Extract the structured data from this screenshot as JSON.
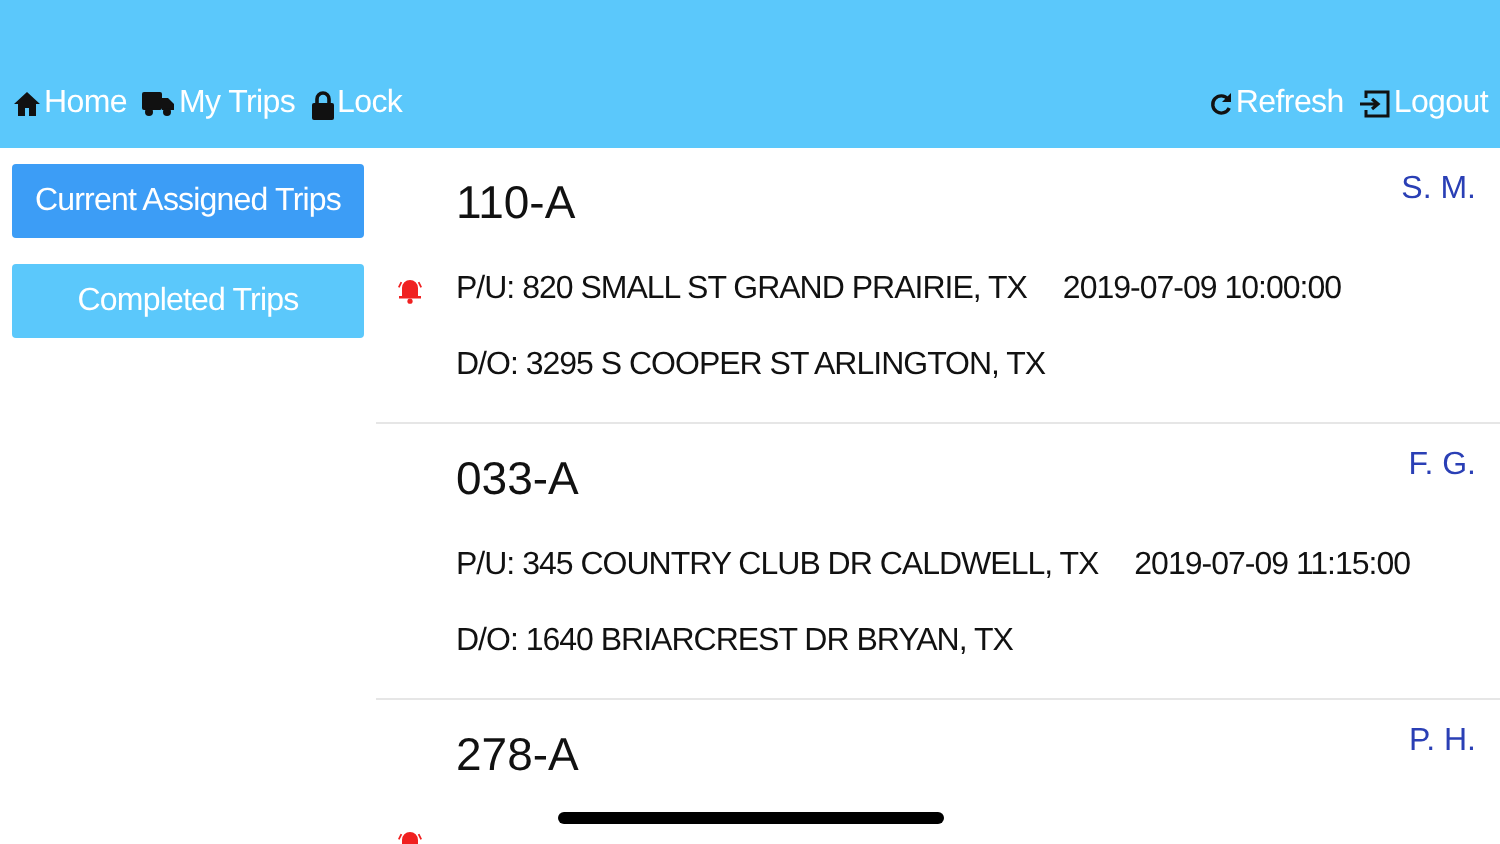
{
  "nav": {
    "left": [
      {
        "label": "Home",
        "kind": "home"
      },
      {
        "label": "My Trips",
        "kind": "truck"
      },
      {
        "label": "Lock",
        "kind": "lock"
      }
    ],
    "right": [
      {
        "label": "Refresh",
        "kind": "refresh"
      },
      {
        "label": "Logout",
        "kind": "logout"
      }
    ]
  },
  "sidebar": {
    "items": [
      {
        "label": "Current Assigned Trips",
        "selected": true
      },
      {
        "label": "Completed Trips",
        "selected": false
      }
    ]
  },
  "trips": [
    {
      "id": "110-A",
      "driver": "S. M.",
      "alert": true,
      "pickup": "P/U: 820 SMALL ST GRAND PRAIRIE, TX",
      "time": "2019-07-09 10:00:00",
      "dropoff": "D/O: 3295 S COOPER ST ARLINGTON, TX"
    },
    {
      "id": "033-A",
      "driver": "F. G.",
      "alert": false,
      "pickup": "P/U: 345 COUNTRY CLUB DR CALDWELL, TX",
      "time": "2019-07-09 11:15:00",
      "dropoff": "D/O: 1640 BRIARCREST DR BRYAN, TX"
    },
    {
      "id": "278-A",
      "driver": "P. H.",
      "alert": true
    }
  ]
}
